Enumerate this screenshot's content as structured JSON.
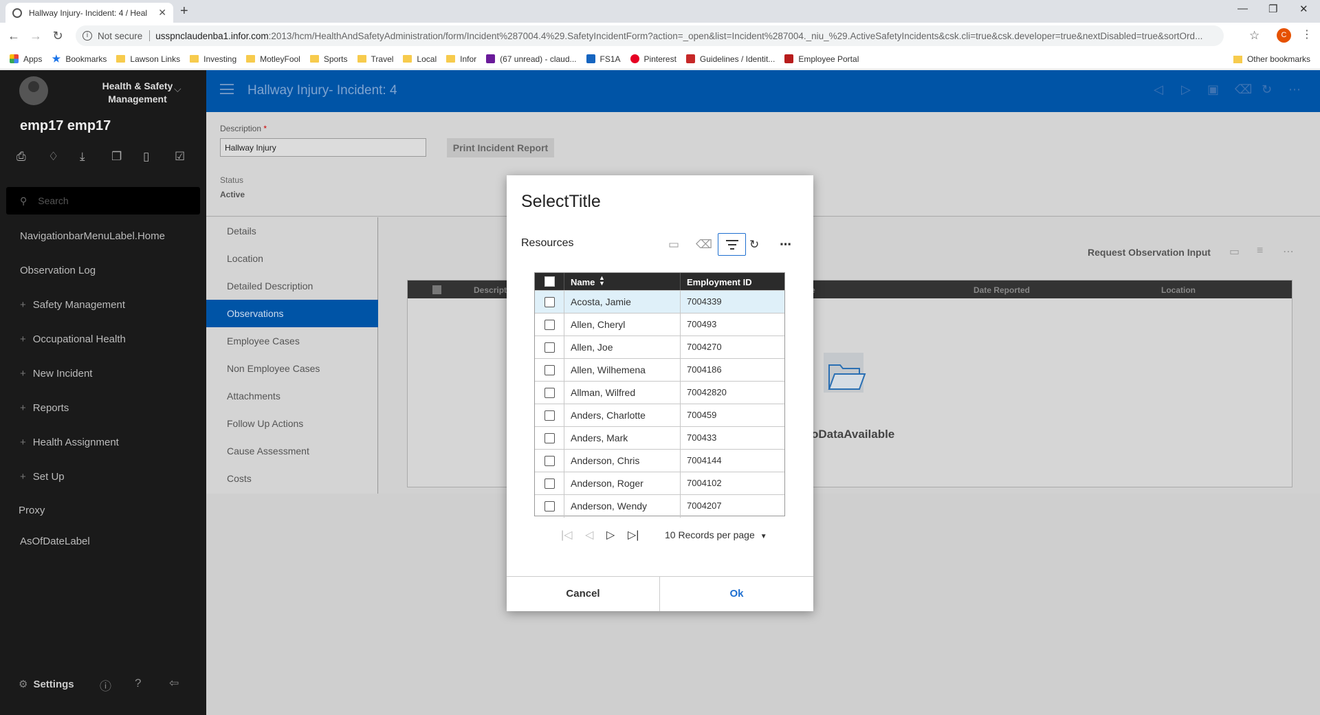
{
  "browser": {
    "tab_title": "Hallway Injury- Incident: 4 / Heal",
    "not_secure": "Not secure",
    "url_host": "usspnclaudenba1.infor.com",
    "url_rest": ":2013/hcm/HealthAndSafetyAdministration/form/Incident%287004.4%29.SafetyIncidentForm?action=_open&list=Incident%287004._niu_%29.ActiveSafetyIncidents&csk.cli=true&csk.developer=true&nextDisabled=true&sortOrd...",
    "profile_initial": "C",
    "bookmarks": [
      {
        "label": "Apps",
        "icon": "apps-grid-icon"
      },
      {
        "label": "Bookmarks",
        "icon": "star-icon"
      },
      {
        "label": "Lawson Links",
        "icon": "folder-icon"
      },
      {
        "label": "Investing",
        "icon": "folder-icon"
      },
      {
        "label": "MotleyFool",
        "icon": "folder-icon"
      },
      {
        "label": "Sports",
        "icon": "folder-icon"
      },
      {
        "label": "Travel",
        "icon": "folder-icon"
      },
      {
        "label": "Local",
        "icon": "folder-icon"
      },
      {
        "label": "Infor",
        "icon": "folder-icon"
      },
      {
        "label": "(67 unread) - claud...",
        "icon": "mail-icon"
      },
      {
        "label": "FS1A",
        "icon": "fs1a-icon"
      },
      {
        "label": "Pinterest",
        "icon": "pinterest-icon"
      },
      {
        "label": "Guidelines / Identit...",
        "icon": "infor-icon"
      },
      {
        "label": "Employee Portal",
        "icon": "portal-icon"
      }
    ],
    "other_bookmarks": "Other bookmarks"
  },
  "sidebar": {
    "app_name": "Health & Safety Management",
    "user": "emp17 emp17",
    "search_placeholder": "Search",
    "items": [
      {
        "label": "NavigationbarMenuLabel.Home",
        "expandable": false
      },
      {
        "label": "Observation Log",
        "expandable": false
      },
      {
        "label": "Safety Management",
        "expandable": true
      },
      {
        "label": "Occupational Health",
        "expandable": true
      },
      {
        "label": "New Incident",
        "expandable": true
      },
      {
        "label": "Reports",
        "expandable": true
      },
      {
        "label": "Health Assignment",
        "expandable": true
      },
      {
        "label": "Set Up",
        "expandable": true
      }
    ],
    "proxy": "Proxy",
    "as_of_date": "AsOfDateLabel",
    "settings": "Settings"
  },
  "header": {
    "title": "Hallway Injury- Incident: 4"
  },
  "form": {
    "description_label": "Description",
    "required_mark": "*",
    "description_value": "Hallway Injury",
    "print_button": "Print Incident Report",
    "status_label": "Status",
    "status_value": "Active"
  },
  "subnav": {
    "items": [
      "Details",
      "Location",
      "Detailed Description",
      "Observations",
      "Employee Cases",
      "Non Employee Cases",
      "Attachments",
      "Follow Up Actions",
      "Cause Assessment",
      "Costs"
    ],
    "active_index": 3
  },
  "observations": {
    "request_button": "Request Observation Input",
    "columns": [
      "Descript",
      "e",
      "Date Reported",
      "Location"
    ],
    "no_data": "oDataAvailable"
  },
  "dialog": {
    "title": "SelectTitle",
    "resources_label": "Resources",
    "columns": {
      "name": "Name",
      "employment_id": "Employment ID"
    },
    "rows": [
      {
        "name": "Acosta, Jamie",
        "id": "7004339",
        "selected": true
      },
      {
        "name": "Allen, Cheryl",
        "id": "700493",
        "selected": false
      },
      {
        "name": "Allen, Joe",
        "id": "7004270",
        "selected": false
      },
      {
        "name": "Allen, Wilhemena",
        "id": "7004186",
        "selected": false
      },
      {
        "name": "Allman, Wilfred",
        "id": "70042820",
        "selected": false
      },
      {
        "name": "Anders, Charlotte",
        "id": "700459",
        "selected": false
      },
      {
        "name": "Anders, Mark",
        "id": "700433",
        "selected": false
      },
      {
        "name": "Anderson, Chris",
        "id": "7004144",
        "selected": false
      },
      {
        "name": "Anderson, Roger",
        "id": "7004102",
        "selected": false
      },
      {
        "name": "Anderson, Wendy",
        "id": "7004207",
        "selected": false
      }
    ],
    "per_page": "10 Records per page",
    "cancel": "Cancel",
    "ok": "Ok"
  },
  "colors": {
    "brand_blue": "#0054a6",
    "sidebar_bg": "#1a1a1a",
    "accent": "#1e6fd0",
    "selected_row": "#dff0f9"
  }
}
